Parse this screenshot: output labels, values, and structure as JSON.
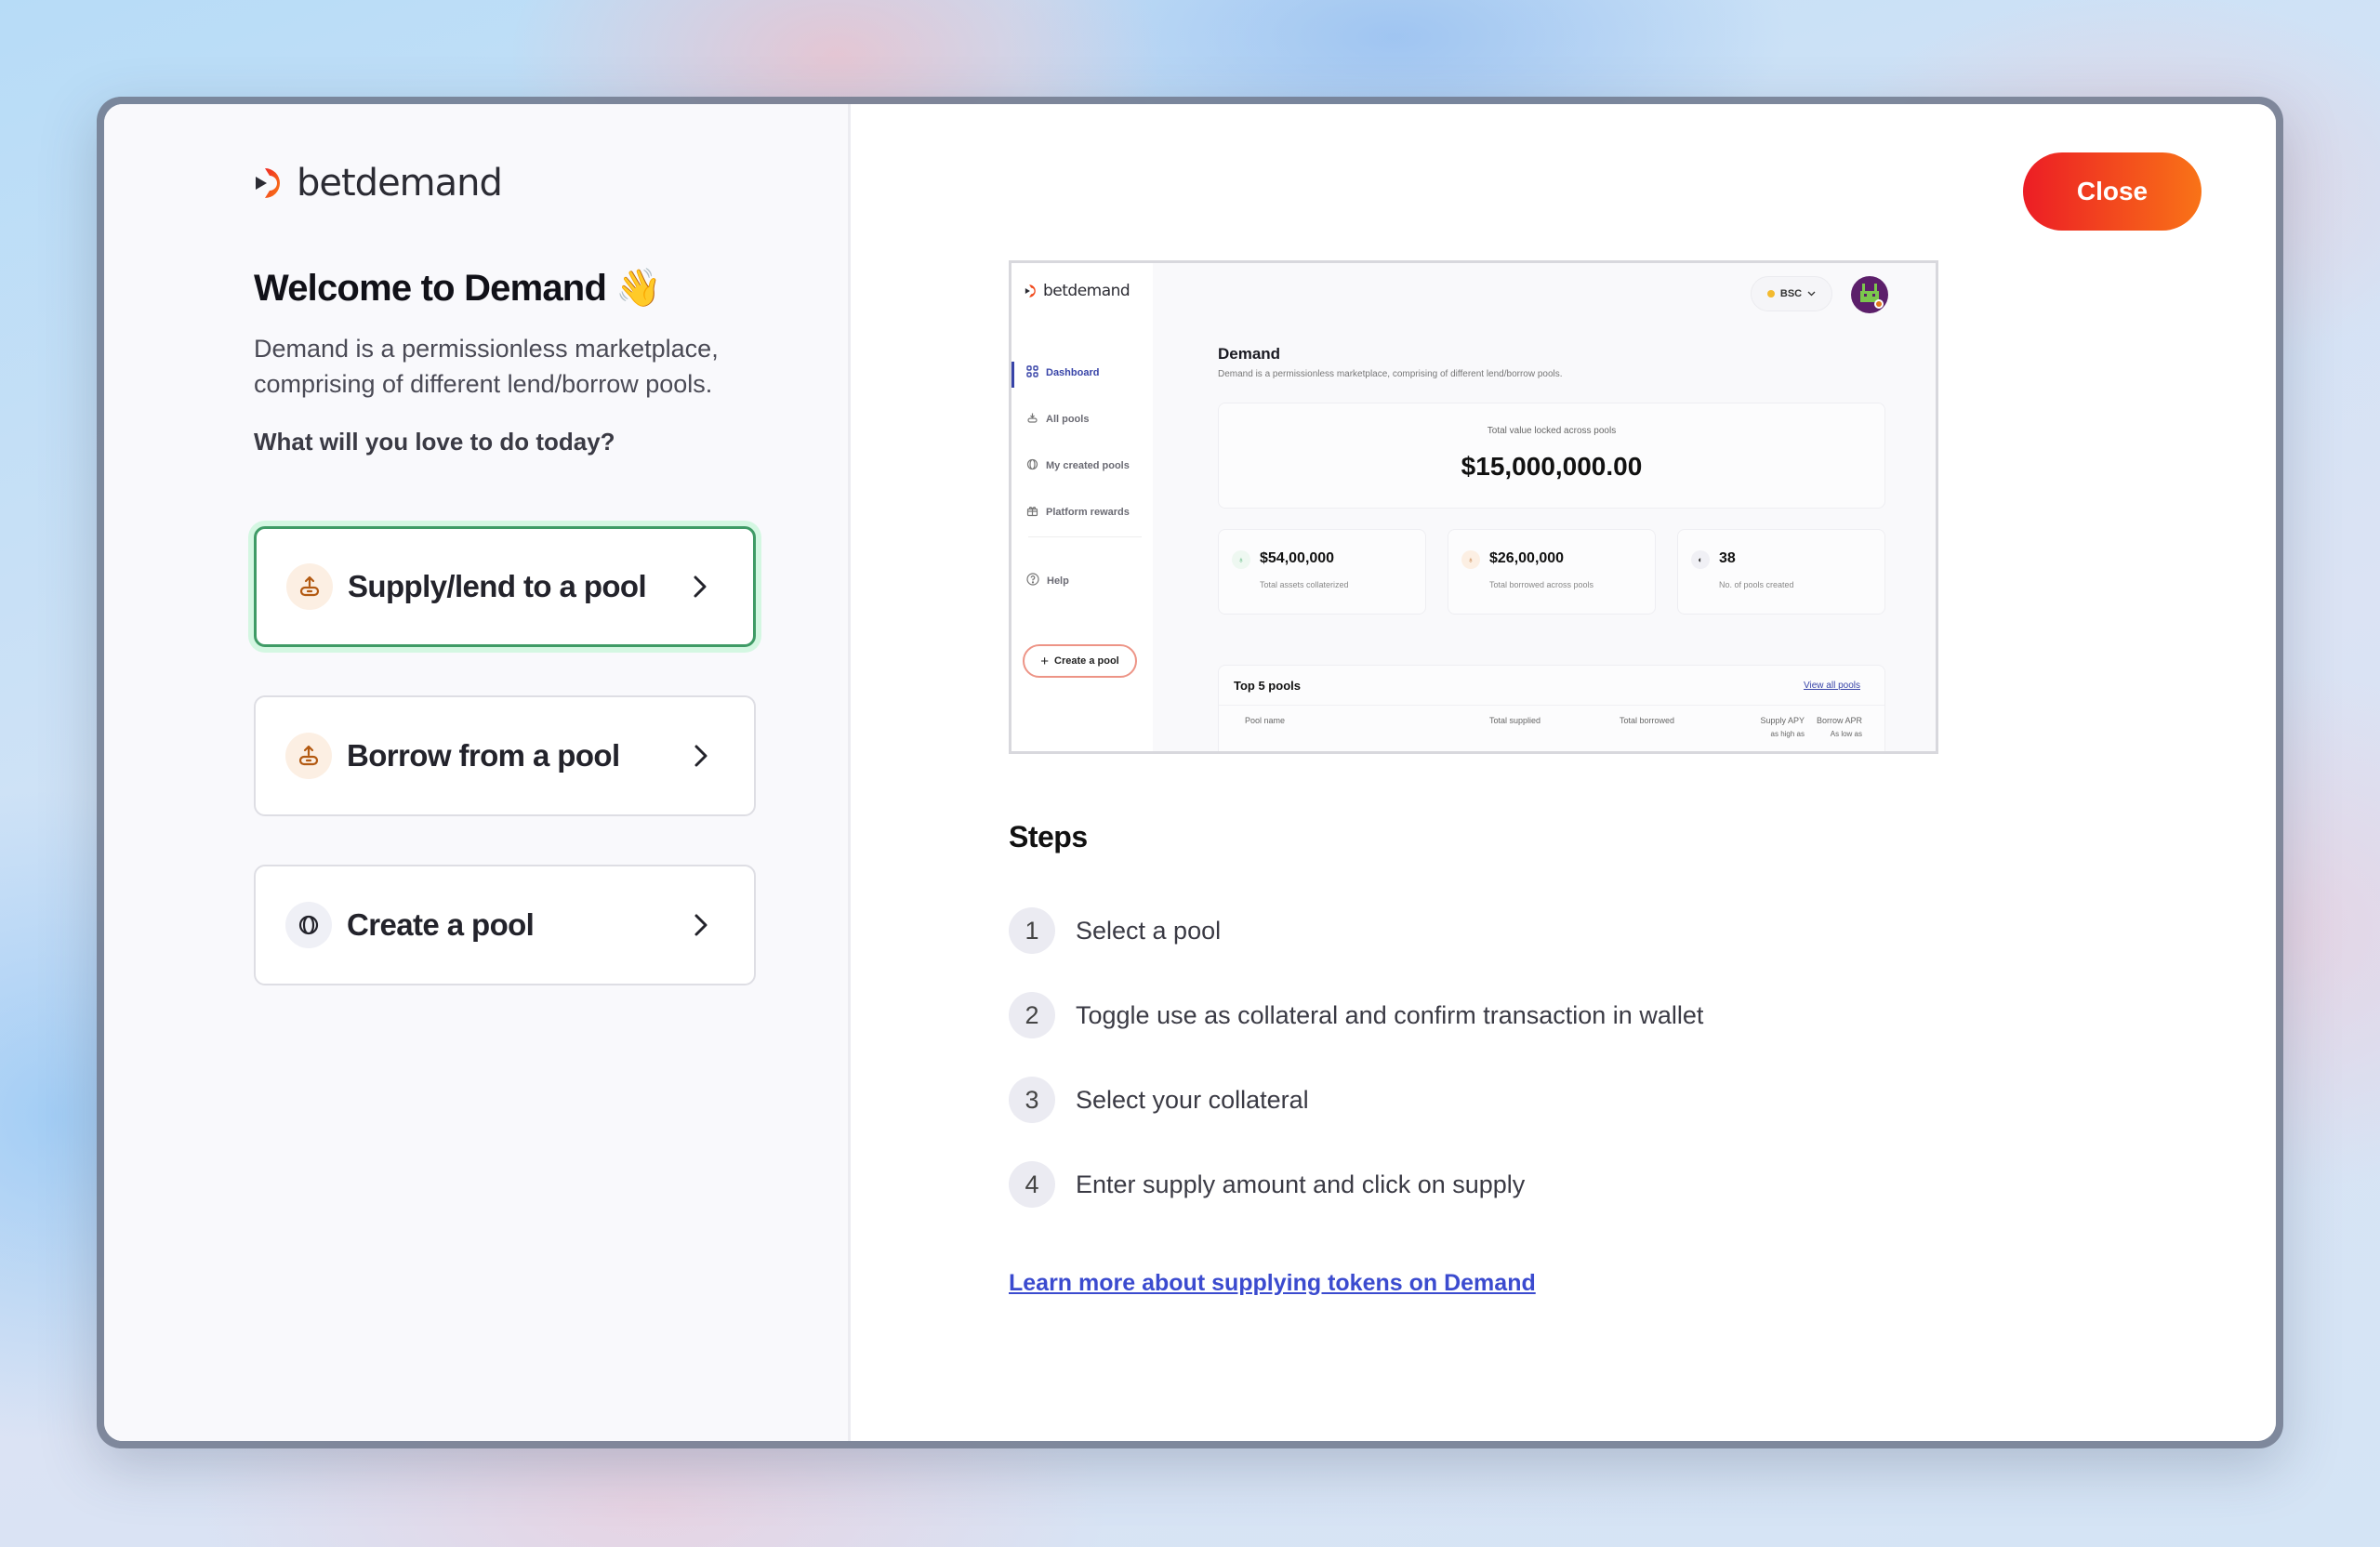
{
  "brand": {
    "name": "betdemand",
    "accent": "#f04a1d"
  },
  "left": {
    "title": "Welcome to Demand",
    "title_emoji": "👋",
    "description": "Demand is a permissionless marketplace, comprising of different lend/borrow pools.",
    "question": "What will you love to do today?",
    "options": [
      {
        "label": "Supply/lend to a pool",
        "icon": "supply-icon",
        "selected": true
      },
      {
        "label": "Borrow from a pool",
        "icon": "borrow-icon",
        "selected": false
      },
      {
        "label": "Create a pool",
        "icon": "pool-icon",
        "selected": false
      }
    ]
  },
  "header": {
    "close_label": "Close"
  },
  "preview": {
    "logo_text": "betdemand",
    "nav": [
      {
        "label": "Dashboard",
        "active": true
      },
      {
        "label": "All pools"
      },
      {
        "label": "My created pools"
      },
      {
        "label": "Platform rewards"
      },
      {
        "label": "Help"
      }
    ],
    "create_pool_label": "Create a pool",
    "network": "BSC",
    "page_title": "Demand",
    "page_subtitle": "Demand is a permissionless marketplace, comprising of different lend/borrow pools.",
    "tvl_label": "Total value locked across pools",
    "tvl_value": "$15,000,000.00",
    "stats": [
      {
        "value": "$54,00,000",
        "label": "Total assets collaterized"
      },
      {
        "value": "$26,00,000",
        "label": "Total borrowed across pools"
      },
      {
        "value": "38",
        "label": "No. of pools created"
      }
    ],
    "table_title": "Top 5 pools",
    "view_all_label": "View all pools",
    "columns": [
      {
        "label": "Pool name",
        "sub": ""
      },
      {
        "label": "Total supplied",
        "sub": ""
      },
      {
        "label": "Total borrowed",
        "sub": ""
      },
      {
        "label": "Supply APY",
        "sub": "as high as"
      },
      {
        "label": "Borrow APR",
        "sub": "As low as"
      }
    ]
  },
  "steps": {
    "title": "Steps",
    "items": [
      {
        "num": "1",
        "text": "Select a pool"
      },
      {
        "num": "2",
        "text": "Toggle use as collateral and confirm transaction in wallet"
      },
      {
        "num": "3",
        "text": "Select your collateral"
      },
      {
        "num": "4",
        "text": "Enter supply amount and click on supply"
      }
    ],
    "learn_more": "Learn more about supplying tokens on Demand"
  }
}
